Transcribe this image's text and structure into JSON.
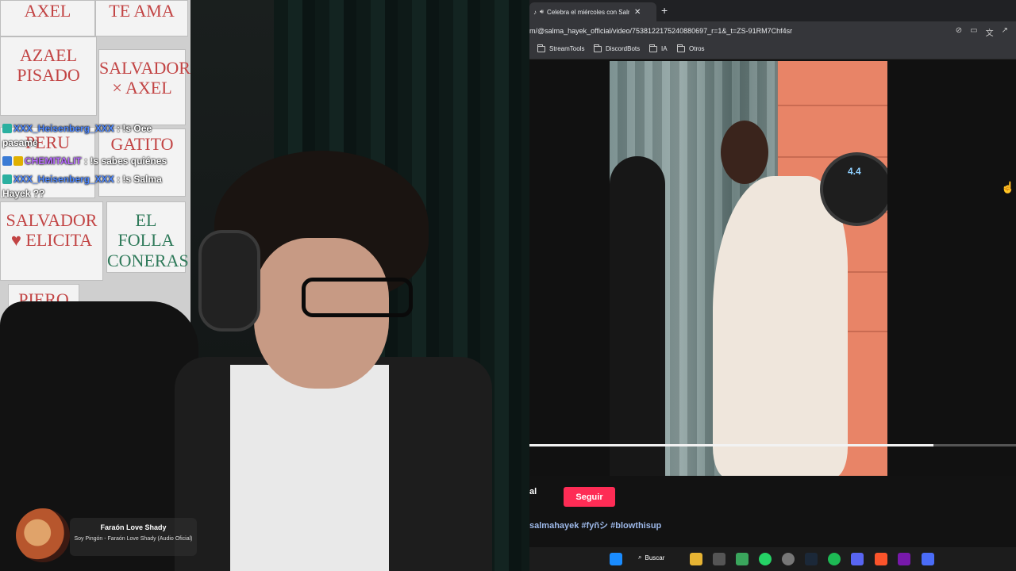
{
  "chat": [
    {
      "user": "XXX_Heisenberg_XXX",
      "message": ": !s Oee pasame",
      "user_color": "#4e88ff"
    },
    {
      "user": "CHEMITALIT",
      "message": ": !s sabes quiénes",
      "user_color": "#b86bff"
    },
    {
      "user": "XXX_Heisenberg_XXX",
      "message": ": !s Salma Hayek ??",
      "user_color": "#4e88ff"
    }
  ],
  "signs": [
    "AXEL",
    "TE AMA",
    "AZAEL PISADO",
    "SALVADOR × AXEL",
    "PERU",
    "GATITO",
    "SALVADOR ♥ ELICITA",
    "EL FOLLA CONERAS",
    "PIERO"
  ],
  "music": {
    "title": "Faraón Love Shady",
    "subtitle": "Soy Pingón - Faraón Love Shady (Audio Oficial)"
  },
  "browser": {
    "tab_title": "Celebra el miércoles con Salm",
    "url": "m/@salma_hayek_official/video/7538122175240880697_r=1&_t=ZS-91RM7Chf4sr",
    "bookmarks": [
      "StreamTools",
      "DiscordBots",
      "IA",
      "Otros"
    ]
  },
  "video": {
    "progress": 0.83,
    "lamp_readout": "4.4"
  },
  "post": {
    "fragment": "al",
    "follow_label": "Seguir",
    "hashtags": "salmahayek #fyñシ #blowthisup"
  },
  "taskbar": {
    "search_label": "Buscar"
  },
  "colors": {
    "accent": "#fe2c55",
    "link": "#9db8e8"
  }
}
